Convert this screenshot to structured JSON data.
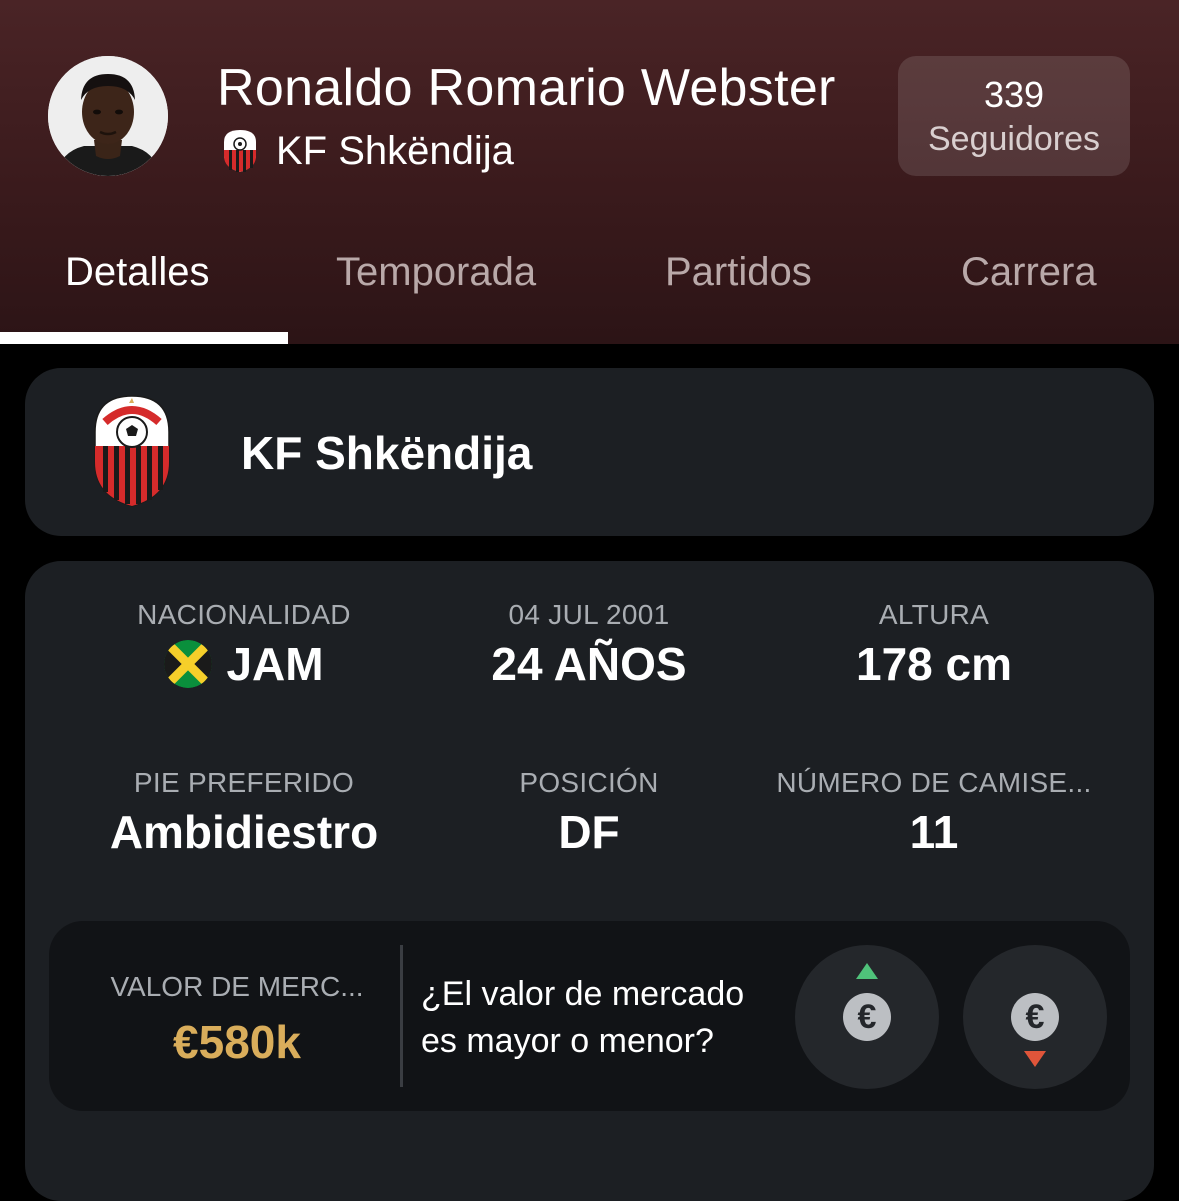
{
  "player": {
    "name": "Ronaldo Romario Webster",
    "club": "KF Shkëndija"
  },
  "followers": {
    "count": "339",
    "label": "Seguidores"
  },
  "tabs": [
    {
      "label": "Detalles",
      "active": true
    },
    {
      "label": "Temporada",
      "active": false
    },
    {
      "label": "Partidos",
      "active": false
    },
    {
      "label": "Carrera",
      "active": false
    }
  ],
  "club_card": {
    "name": "KF Shkëndija",
    "crest_icon": "kf-shkendija-crest-icon"
  },
  "details": {
    "nationality": {
      "label": "NACIONALIDAD",
      "value": "JAM",
      "flag_icon": "jamaica-flag-icon"
    },
    "birthdate": {
      "label": "04 JUL 2001",
      "value": "24 AÑOS"
    },
    "height": {
      "label": "ALTURA",
      "value": "178 cm"
    },
    "foot": {
      "label": "PIE PREFERIDO",
      "value": "Ambidiestro"
    },
    "position": {
      "label": "POSICIÓN",
      "value": "DF"
    },
    "shirt": {
      "label": "NÚMERO DE CAMISE...",
      "value": "11"
    }
  },
  "market": {
    "label": "VALOR DE MERC...",
    "value": "€580k",
    "question": "¿El valor de mercado es mayor o menor?",
    "up_icon": "euro-up-icon",
    "down_icon": "euro-down-icon",
    "euro_symbol": "€"
  },
  "colors": {
    "header_bg": "#4a2426",
    "card_bg": "#1c1f23",
    "market_value": "#d9ad5b",
    "up_arrow": "#4fc27a",
    "down_arrow": "#e0553a"
  }
}
